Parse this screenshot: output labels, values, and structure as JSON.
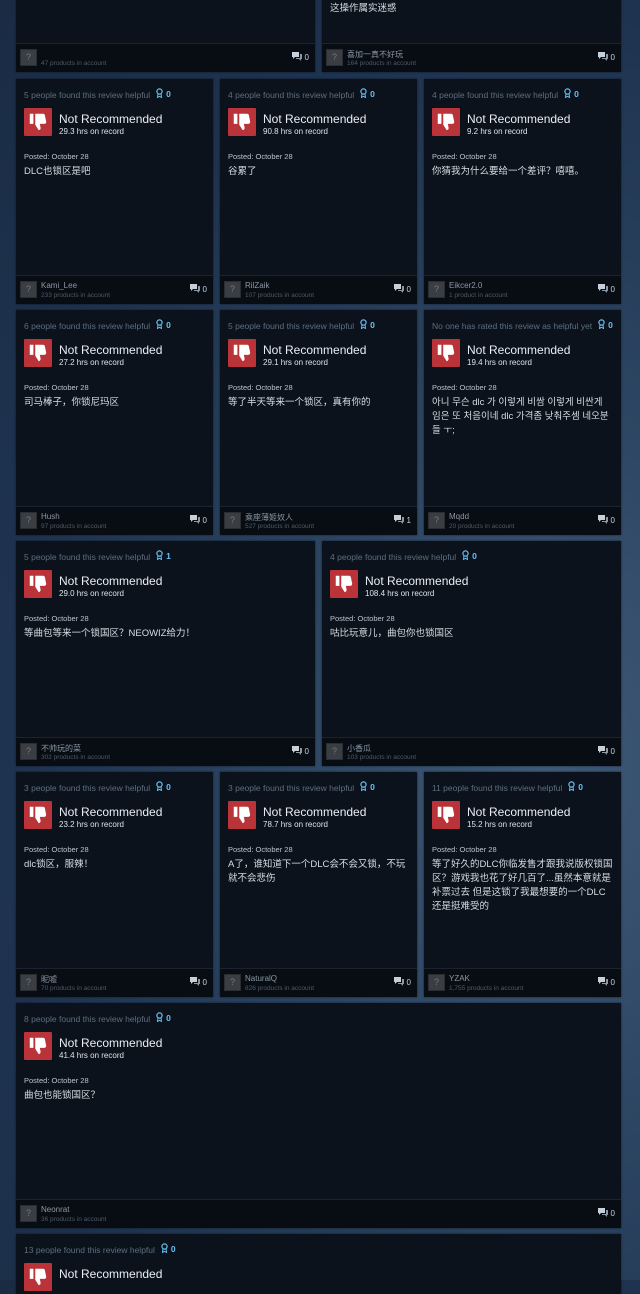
{
  "colors": {
    "thumb_bg": "#b93338",
    "award": "#66c0f4",
    "card_bg": "#0c121b"
  },
  "icons": {
    "thumb": "thumbs-down-icon",
    "award": "award-ribbon-icon",
    "comment": "comment-icon",
    "avatar_placeholder": "?"
  },
  "top_partial": [
    {
      "text": "",
      "products": "47 products in account",
      "username": "",
      "comments": "0"
    },
    {
      "text": "这操作属实迷惑",
      "username": "喜加一真不好玩",
      "products": "164 products in account",
      "comments": "0"
    }
  ],
  "reviews": [
    {
      "helpful": "5 people found this review helpful",
      "awards": "0",
      "title": "Not Recommended",
      "hours": "29.3 hrs on record",
      "posted": "Posted: October 28",
      "text": "DLC也锁区是吧",
      "username": "Kami_Lee",
      "products": "233 products in account",
      "comments": "0"
    },
    {
      "helpful": "4 people found this review helpful",
      "awards": "0",
      "title": "Not Recommended",
      "hours": "90.8 hrs on record",
      "posted": "Posted: October 28",
      "text": "谷累了",
      "username": "RilZaik",
      "products": "107 products in account",
      "comments": "0"
    },
    {
      "helpful": "4 people found this review helpful",
      "awards": "0",
      "title": "Not Recommended",
      "hours": "9.2 hrs on record",
      "posted": "Posted: October 28",
      "text": "你猜我为什么要给一个差评？嘻嘻。",
      "username": "Eikcer2.0",
      "products": "1 product in account",
      "comments": "0"
    },
    {
      "helpful": "6 people found this review helpful",
      "awards": "0",
      "title": "Not Recommended",
      "hours": "27.2 hrs on record",
      "posted": "Posted: October 28",
      "text": "司马棒子，你锁尼玛区",
      "username": "Hush",
      "products": "97 products in account",
      "comments": "0"
    },
    {
      "helpful": "5 people found this review helpful",
      "awards": "0",
      "title": "Not Recommended",
      "hours": "29.1 hrs on record",
      "posted": "Posted: October 28",
      "text": "等了半天等来一个锁区，真有你的",
      "username": "乘座薄姬奴人",
      "products": "527 products in account",
      "comments": "1"
    },
    {
      "helpful": "No one has rated this review as helpful yet",
      "awards": "0",
      "title": "Not Recommended",
      "hours": "19.4 hrs on record",
      "posted": "Posted: October 28",
      "text": "아니 무슨 dlc 가 이렇게 비쌈 이렇게 비싼게 임은 또 처음이네 dlc 가격좀 낮춰주셈 네오분들 ㅜ;",
      "username": "Mqdd",
      "products": "20 products in account",
      "comments": "0"
    },
    {
      "helpful": "5 people found this review helpful",
      "awards": "1",
      "title": "Not Recommended",
      "hours": "29.0 hrs on record",
      "posted": "Posted: October 28",
      "text": "等曲包等来一个锁国区？NEOWIZ给力！",
      "username": "不帅玩的菜",
      "products": "302 products in account",
      "comments": "0"
    },
    {
      "helpful": "4 people found this review helpful",
      "awards": "0",
      "title": "Not Recommended",
      "hours": "108.4 hrs on record",
      "posted": "Posted: October 28",
      "text": "咕比玩意儿，曲包你也锁国区",
      "username": "小香瓜",
      "products": "103 products in account",
      "comments": "0"
    },
    {
      "helpful": "3 people found this review helpful",
      "awards": "0",
      "title": "Not Recommended",
      "hours": "23.2 hrs on record",
      "posted": "Posted: October 28",
      "text": "dlc锁区，服辣！",
      "username": "昵嘘",
      "products": "70 products in account",
      "comments": "0"
    },
    {
      "helpful": "3 people found this review helpful",
      "awards": "0",
      "title": "Not Recommended",
      "hours": "78.7 hrs on record",
      "posted": "Posted: October 28",
      "text": "A了，谁知道下一个DLC会不会又锁，不玩就不会悲伤",
      "username": "NaturalQ",
      "products": "826 products in account",
      "comments": "0"
    },
    {
      "helpful": "11 people found this review helpful",
      "awards": "0",
      "title": "Not Recommended",
      "hours": "15.2 hrs on record",
      "posted": "Posted: October 28",
      "text": "等了好久的DLC你临发售才跟我说版权锁国区？游戏我也花了好几百了...虽然本意就是补票过去 但是这锁了我最想要的一个DLC还是挺难受的",
      "username": "YZAK",
      "products": "1,755 products in account",
      "comments": "0"
    },
    {
      "helpful": "8 people found this review helpful",
      "awards": "0",
      "title": "Not Recommended",
      "hours": "41.4 hrs on record",
      "posted": "Posted: October 28",
      "text": "曲包也能锁国区？",
      "username": "Neonrat",
      "products": "36 products in account",
      "comments": "0"
    },
    {
      "helpful": "13 people found this review helpful",
      "awards": "0",
      "title": "Not Recommended",
      "hours": "",
      "posted": "",
      "text": "",
      "username": "",
      "products": "",
      "comments": ""
    }
  ]
}
